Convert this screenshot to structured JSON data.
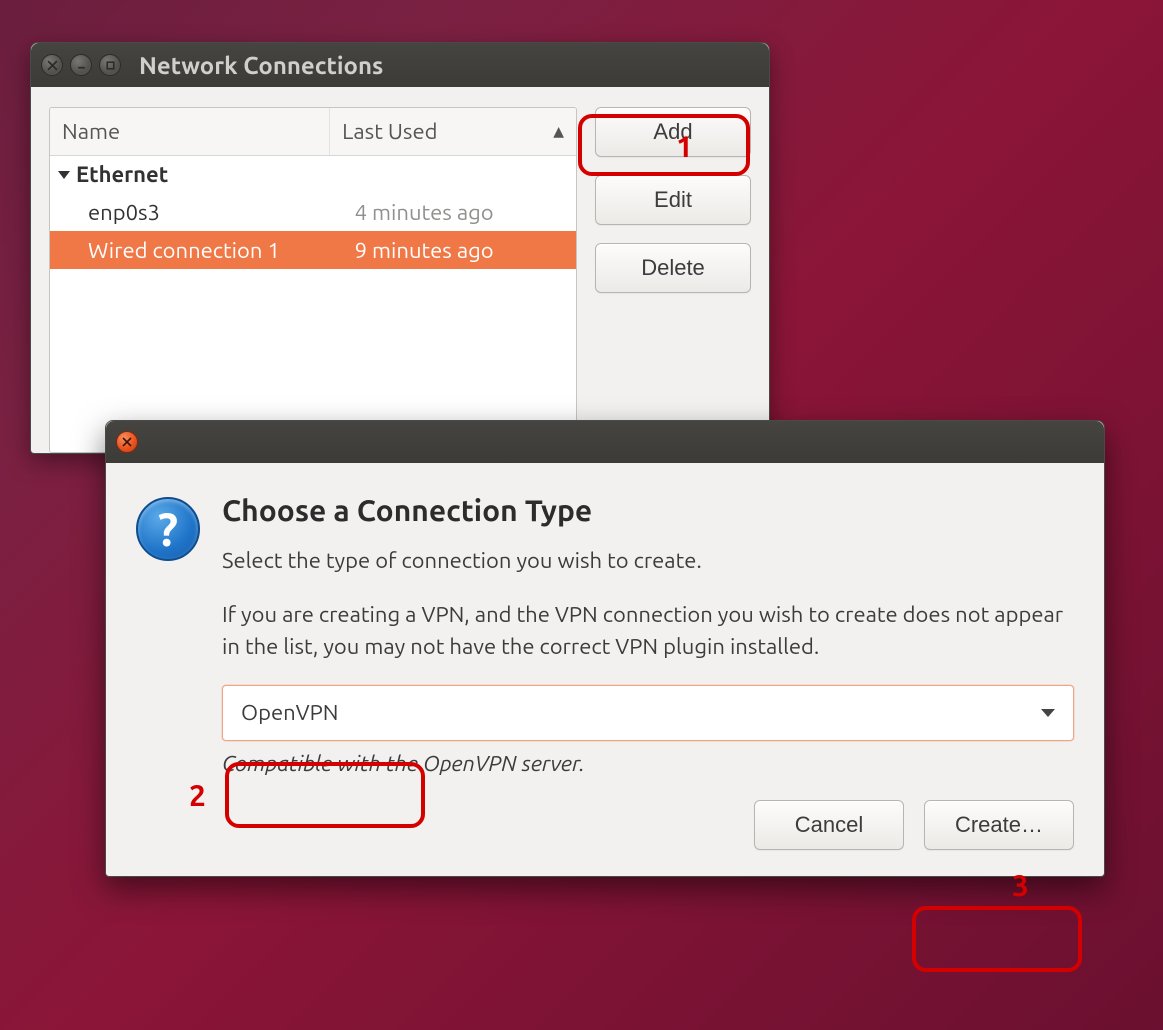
{
  "window1": {
    "title": "Network Connections",
    "columns": {
      "name": "Name",
      "last_used": "Last Used"
    },
    "group": "Ethernet",
    "rows": [
      {
        "name": "enp0s3",
        "last": "4 minutes ago",
        "selected": false
      },
      {
        "name": "Wired connection 1",
        "last": "9 minutes ago",
        "selected": true
      }
    ],
    "buttons": {
      "add": "Add",
      "edit": "Edit",
      "delete": "Delete"
    }
  },
  "dialog": {
    "title": "Choose a Connection Type",
    "p1": "Select the type of connection you wish to create.",
    "p2": "If you are creating a VPN, and the VPN connection you wish to create does not appear in the list, you may not have the correct VPN plugin installed.",
    "combo_value": "OpenVPN",
    "combo_desc": "Compatible with the OpenVPN server.",
    "cancel": "Cancel",
    "create": "Create…"
  },
  "annotations": {
    "one": "1",
    "two": "2",
    "three": "3"
  },
  "colors": {
    "accent_orange": "#f07746",
    "annotation_red": "#d40000",
    "ubuntu_close": "#e95420"
  }
}
